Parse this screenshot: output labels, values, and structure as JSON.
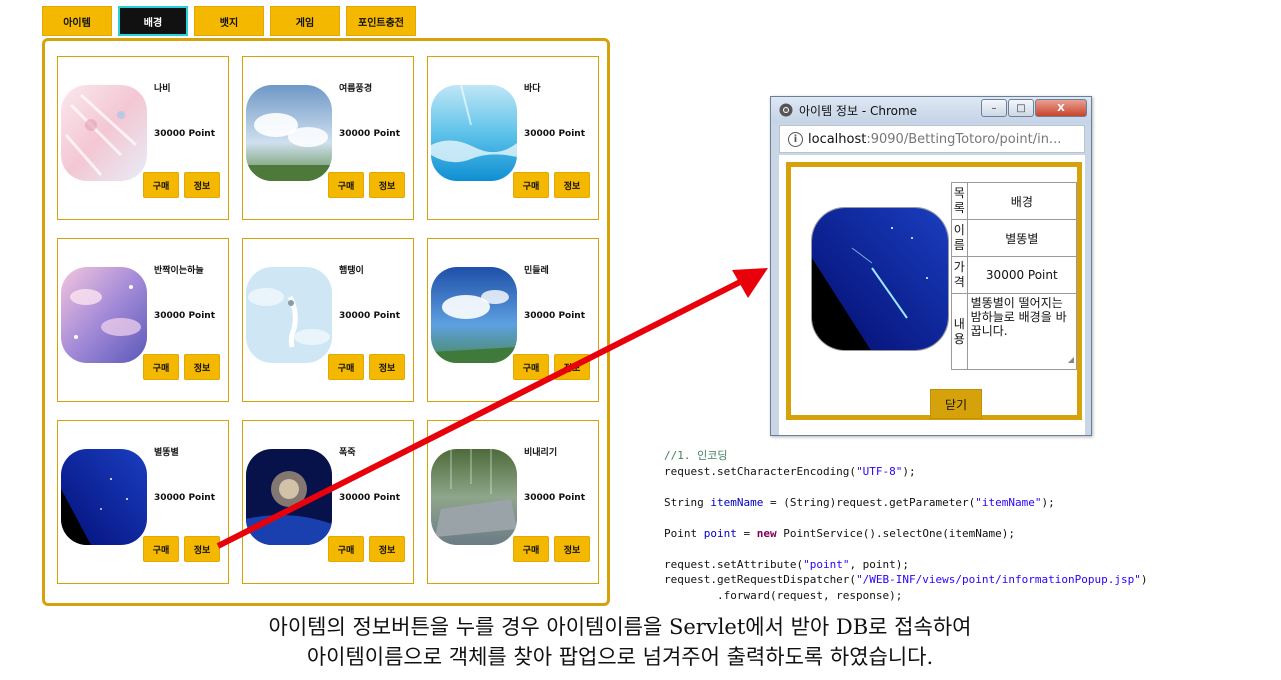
{
  "tabs": [
    {
      "label": "아이템"
    },
    {
      "label": "배경"
    },
    {
      "label": "뱃지"
    },
    {
      "label": "게임"
    },
    {
      "label": "포인트충전"
    }
  ],
  "items": [
    {
      "name": "나비",
      "price": "30000 Point",
      "buy": "구매",
      "info": "정보"
    },
    {
      "name": "여름풍경",
      "price": "30000 Point",
      "buy": "구매",
      "info": "정보"
    },
    {
      "name": "바다",
      "price": "30000 Point",
      "buy": "구매",
      "info": "정보"
    },
    {
      "name": "반짝이는하늘",
      "price": "30000 Point",
      "buy": "구매",
      "info": "정보"
    },
    {
      "name": "햄탱이",
      "price": "30000 Point",
      "buy": "구매",
      "info": "정보"
    },
    {
      "name": "민들레",
      "price": "30000 Point",
      "buy": "구매",
      "info": "정보"
    },
    {
      "name": "별똥별",
      "price": "30000 Point",
      "buy": "구매",
      "info": "정보"
    },
    {
      "name": "폭죽",
      "price": "30000 Point",
      "buy": "구매",
      "info": "정보"
    },
    {
      "name": "비내리기",
      "price": "30000 Point",
      "buy": "구매",
      "info": "정보"
    }
  ],
  "popup": {
    "title": "아이템 정보 - Chrome",
    "min": "–",
    "max": "□",
    "close": "X",
    "url_host": "localhost",
    "url_path": ":9090/BettingTotoro/point/in...",
    "info_icon": "i",
    "rows": [
      {
        "label": "목\n록",
        "value": "배경"
      },
      {
        "label": "이\n름",
        "value": "별똥별"
      },
      {
        "label": "가\n격",
        "value": "30000 Point"
      },
      {
        "label": "내\n용",
        "value": "별똥별이 떨어지는 밤하늘로 배경을 바꿉니다."
      }
    ],
    "close_button": "닫기"
  },
  "code": {
    "line1": "//1. 인코딩",
    "line2a": "request.setCharacterEncoding(",
    "line2b": "\"UTF-8\"",
    "line2c": ");",
    "line3a": "String ",
    "line3b": "itemName",
    "line3c": " = (String)request.getParameter(",
    "line3d": "\"itemName\"",
    "line3e": ");",
    "line4a": "Point ",
    "line4b": "point",
    "line4c": " = ",
    "line4d": "new",
    "line4e": " PointService().selectOne(itemName);",
    "line5a": "request.setAttribute(",
    "line5b": "\"point\"",
    "line5c": ", point);",
    "line6a": "request.getRequestDispatcher(",
    "line6b": "\"/WEB-INF/views/point/informationPopup.jsp\"",
    "line6c": ")",
    "line7": "        .forward(request, response);"
  },
  "caption": {
    "line1": "아이템의 정보버튼을 누를 경우 아이템이름을 Servlet에서 받아 DB로 접속하여",
    "line2": "아이템이름으로 객체를 찾아 팝업으로 넘겨주어 출력하도록 하였습니다."
  },
  "colors": {
    "gold": "#d6a20c",
    "tab_yellow": "#f5b800",
    "arrow": "#e8000b"
  }
}
